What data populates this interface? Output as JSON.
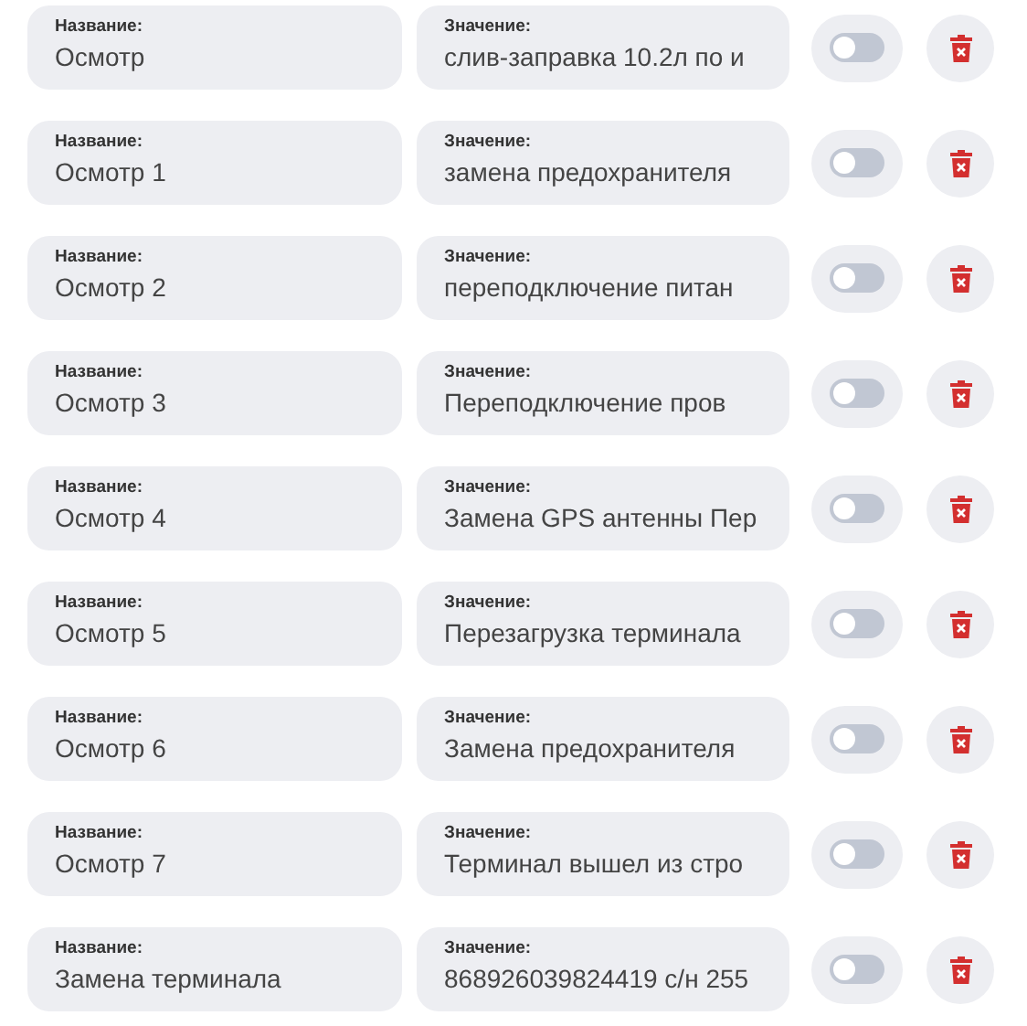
{
  "rows": [
    {
      "name_label": "Название:",
      "name": "Осмотр",
      "value_label": "Значение:",
      "value": "слив-заправка 10.2л по и",
      "enabled": false
    },
    {
      "name_label": "Название:",
      "name": "Осмотр 1",
      "value_label": "Значение:",
      "value": "замена предохранителя",
      "enabled": false
    },
    {
      "name_label": "Название:",
      "name": "Осмотр 2",
      "value_label": "Значение:",
      "value": "переподключение питан",
      "enabled": false
    },
    {
      "name_label": "Название:",
      "name": "Осмотр 3",
      "value_label": "Значение:",
      "value": "Переподключение пров",
      "enabled": false
    },
    {
      "name_label": "Название:",
      "name": "Осмотр 4",
      "value_label": "Значение:",
      "value": "Замена GPS антенны Пер",
      "enabled": false
    },
    {
      "name_label": "Название:",
      "name": "Осмотр 5",
      "value_label": "Значение:",
      "value": "Перезагрузка терминала",
      "enabled": false
    },
    {
      "name_label": "Название:",
      "name": "Осмотр 6",
      "value_label": "Значение:",
      "value": "Замена предохранителя",
      "enabled": false
    },
    {
      "name_label": "Название:",
      "name": "Осмотр 7",
      "value_label": "Значение:",
      "value": "Терминал вышел из стро",
      "enabled": false
    },
    {
      "name_label": "Название:",
      "name": "Замена терминала",
      "value_label": "Значение:",
      "value": "868926039824419 с/н 255",
      "enabled": false
    }
  ]
}
